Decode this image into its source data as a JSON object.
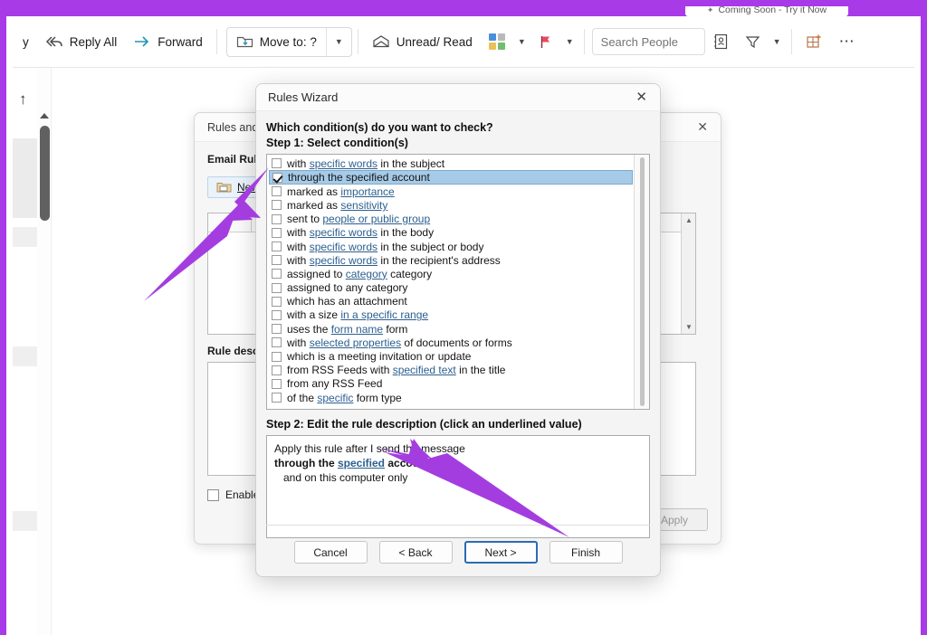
{
  "accent": {
    "frame_purple": "#a93ae8",
    "arrow_purple": "#a43de0",
    "selection_blue": "#a6cbe8",
    "link_blue": "#2b5f8f"
  },
  "top_strip": {
    "coming_soon": "Coming Soon - Try it Now",
    "icon": "sparkle-icon"
  },
  "toolbar": {
    "reply_truncated": "y",
    "reply_all": "Reply All",
    "forward": "Forward",
    "move_to": "Move to: ?",
    "unread_read": "Unread/ Read",
    "search_people_placeholder": "Search People",
    "search_people_value": "",
    "icons": {
      "reply_all": "reply-all-icon",
      "forward": "forward-arrow-icon",
      "move_to": "move-to-folder-icon",
      "unread_read": "open-envelope-icon",
      "categorize": "categorize-grid-icon",
      "flag": "flag-icon",
      "address_book": "address-book-icon",
      "filter": "filter-funnel-icon",
      "add_in": "add-in-grid-icon",
      "more": "ellipsis-icon"
    },
    "categorize_colors": [
      "#4a90d9",
      "#b9b9b9",
      "#e8c15a",
      "#6fbf6f"
    ],
    "flag_color": "#e8495f"
  },
  "sidebar": {
    "up_arrow_icon": "scroll-up-arrow-icon"
  },
  "rules_and_alerts": {
    "title": "Rules and A",
    "close_icon": "close-icon",
    "tab_label": "Email Rule",
    "new_rule_button": "New",
    "new_rule_icon": "new-rule-folder-icon",
    "rule_column_header": "R",
    "description_label": "Rule descr",
    "enable_label": "Enable",
    "apply_button": "Apply"
  },
  "rules_wizard": {
    "title": "Rules Wizard",
    "close_icon": "close-icon",
    "question": "Which condition(s) do you want to check?",
    "step1_label": "Step 1: Select condition(s)",
    "step2_label": "Step 2: Edit the rule description (click an underlined value)",
    "conditions": [
      {
        "pre": "with ",
        "link": "specific words",
        "post": " in the subject",
        "checked": false,
        "selected": false
      },
      {
        "pre": "through the specified account",
        "link": "",
        "post": "",
        "checked": true,
        "selected": true
      },
      {
        "pre": "marked as ",
        "link": "importance",
        "post": "",
        "checked": false,
        "selected": false
      },
      {
        "pre": "marked as ",
        "link": "sensitivity",
        "post": "",
        "checked": false,
        "selected": false
      },
      {
        "pre": "sent to ",
        "link": "people or public group",
        "post": "",
        "checked": false,
        "selected": false
      },
      {
        "pre": "with ",
        "link": "specific words",
        "post": " in the body",
        "checked": false,
        "selected": false
      },
      {
        "pre": "with ",
        "link": "specific words",
        "post": " in the subject or body",
        "checked": false,
        "selected": false
      },
      {
        "pre": "with ",
        "link": "specific words",
        "post": " in the recipient's address",
        "checked": false,
        "selected": false
      },
      {
        "pre": "assigned to ",
        "link": "category",
        "post": " category",
        "checked": false,
        "selected": false
      },
      {
        "pre": "assigned to any category",
        "link": "",
        "post": "",
        "checked": false,
        "selected": false
      },
      {
        "pre": "which has an attachment",
        "link": "",
        "post": "",
        "checked": false,
        "selected": false
      },
      {
        "pre": "with a size ",
        "link": "in a specific range",
        "post": "",
        "checked": false,
        "selected": false
      },
      {
        "pre": "uses the ",
        "link": "form name",
        "post": " form",
        "checked": false,
        "selected": false
      },
      {
        "pre": "with ",
        "link": "selected properties",
        "post": " of documents or forms",
        "checked": false,
        "selected": false
      },
      {
        "pre": "which is a meeting invitation or update",
        "link": "",
        "post": "",
        "checked": false,
        "selected": false
      },
      {
        "pre": "from RSS Feeds with ",
        "link": "specified text",
        "post": " in the title",
        "checked": false,
        "selected": false
      },
      {
        "pre": "from any RSS Feed",
        "link": "",
        "post": "",
        "checked": false,
        "selected": false
      },
      {
        "pre": "of the ",
        "link": "specific",
        "post": " form type",
        "checked": false,
        "selected": false
      }
    ],
    "description": {
      "line1": "Apply this rule after I send the message",
      "line2_pre": "through the ",
      "line2_link": "specified",
      "line2_post": " account",
      "line3": "and on this computer only"
    },
    "buttons": {
      "cancel": "Cancel",
      "back": "< Back",
      "next": "Next >",
      "finish": "Finish"
    }
  }
}
